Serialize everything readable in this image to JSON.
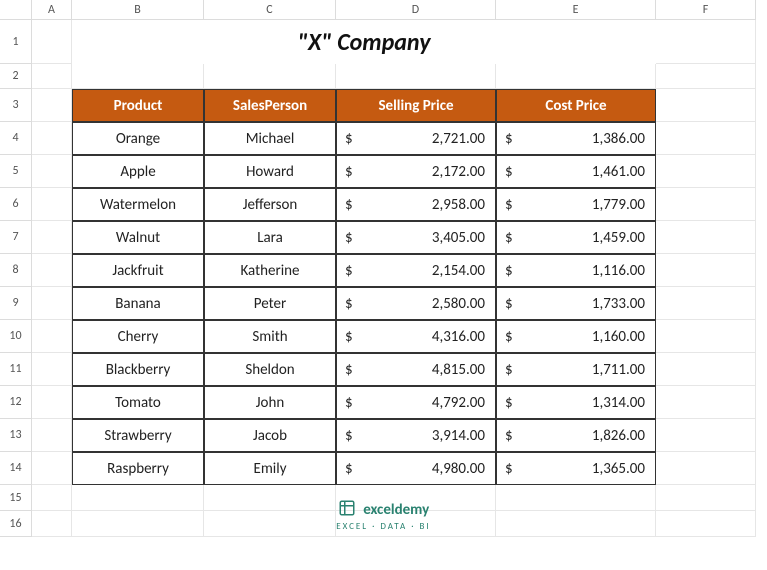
{
  "columns": [
    "A",
    "B",
    "C",
    "D",
    "E",
    "F"
  ],
  "rows": [
    "1",
    "2",
    "3",
    "4",
    "5",
    "6",
    "7",
    "8",
    "9",
    "10",
    "11",
    "12",
    "13",
    "14",
    "15",
    "16"
  ],
  "title": "\"X\" Company",
  "table": {
    "headers": {
      "product": "Product",
      "salesperson": "SalesPerson",
      "selling": "Selling Price",
      "cost": "Cost Price"
    },
    "rows": [
      {
        "product": "Orange",
        "person": "Michael",
        "sell": "2,721.00",
        "cost": "1,386.00"
      },
      {
        "product": "Apple",
        "person": "Howard",
        "sell": "2,172.00",
        "cost": "1,461.00"
      },
      {
        "product": "Watermelon",
        "person": "Jefferson",
        "sell": "2,958.00",
        "cost": "1,779.00"
      },
      {
        "product": "Walnut",
        "person": "Lara",
        "sell": "3,405.00",
        "cost": "1,459.00"
      },
      {
        "product": "Jackfruit",
        "person": "Katherine",
        "sell": "2,154.00",
        "cost": "1,116.00"
      },
      {
        "product": "Banana",
        "person": "Peter",
        "sell": "2,580.00",
        "cost": "1,733.00"
      },
      {
        "product": "Cherry",
        "person": "Smith",
        "sell": "4,316.00",
        "cost": "1,160.00"
      },
      {
        "product": "Blackberry",
        "person": "Sheldon",
        "sell": "4,815.00",
        "cost": "1,711.00"
      },
      {
        "product": "Tomato",
        "person": "John",
        "sell": "4,792.00",
        "cost": "1,314.00"
      },
      {
        "product": "Strawberry",
        "person": "Jacob",
        "sell": "3,914.00",
        "cost": "1,826.00"
      },
      {
        "product": "Raspberry",
        "person": "Emily",
        "sell": "4,980.00",
        "cost": "1,365.00"
      }
    ]
  },
  "currency": "$",
  "footer": {
    "brand": "exceldemy",
    "sub": "EXCEL · DATA · BI"
  },
  "chart_data": {
    "type": "table",
    "title": "\"X\" Company",
    "columns": [
      "Product",
      "SalesPerson",
      "Selling Price",
      "Cost Price"
    ],
    "rows": [
      [
        "Orange",
        "Michael",
        2721.0,
        1386.0
      ],
      [
        "Apple",
        "Howard",
        2172.0,
        1461.0
      ],
      [
        "Watermelon",
        "Jefferson",
        2958.0,
        1779.0
      ],
      [
        "Walnut",
        "Lara",
        3405.0,
        1459.0
      ],
      [
        "Jackfruit",
        "Katherine",
        2154.0,
        1116.0
      ],
      [
        "Banana",
        "Peter",
        2580.0,
        1733.0
      ],
      [
        "Cherry",
        "Smith",
        4316.0,
        1160.0
      ],
      [
        "Blackberry",
        "Sheldon",
        4815.0,
        1711.0
      ],
      [
        "Tomato",
        "John",
        4792.0,
        1314.0
      ],
      [
        "Strawberry",
        "Jacob",
        3914.0,
        1826.0
      ],
      [
        "Raspberry",
        "Emily",
        4980.0,
        1365.0
      ]
    ]
  }
}
